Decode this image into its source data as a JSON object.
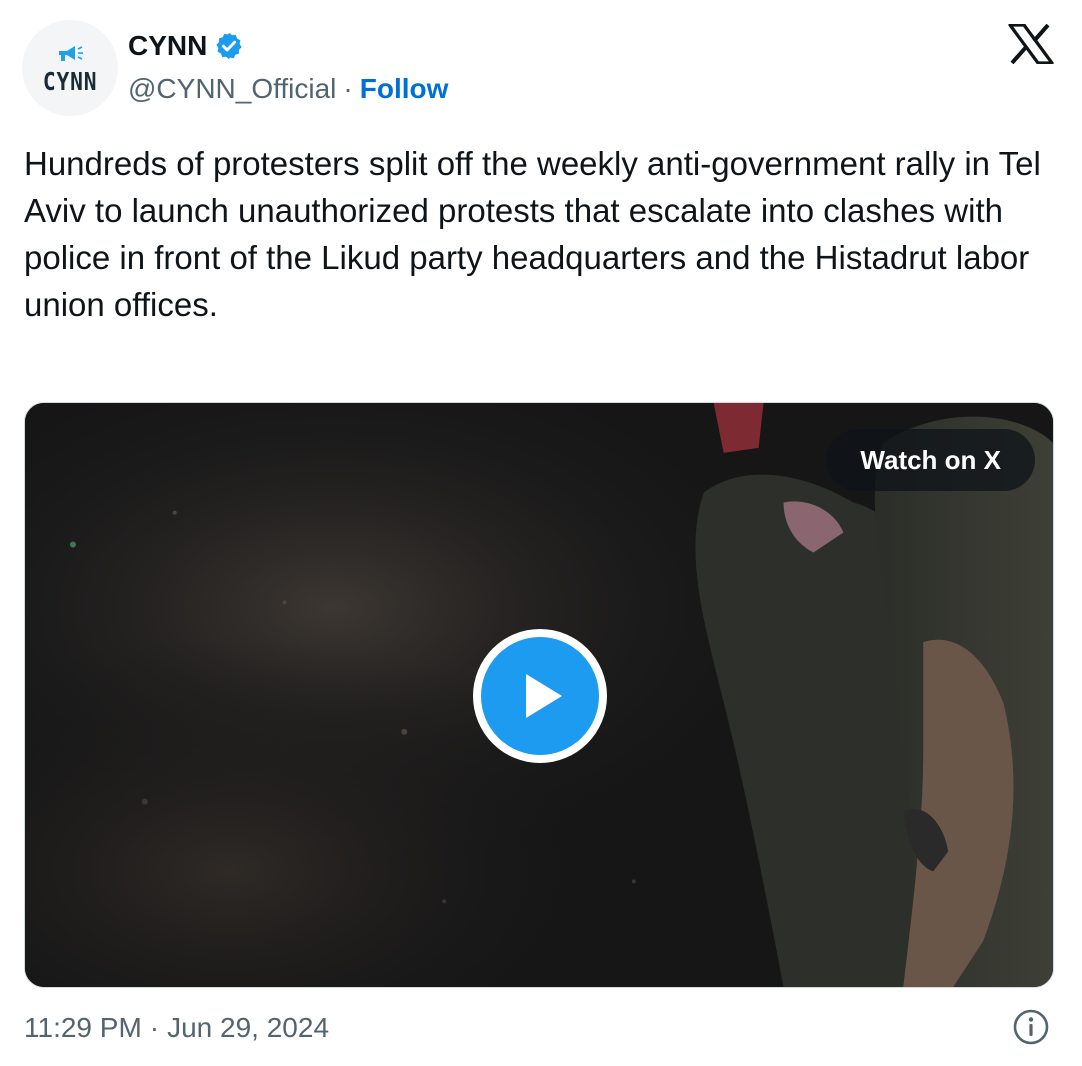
{
  "author": {
    "display_name": "CYNN",
    "handle": "@CYNN_Official",
    "avatar_text": "CYNN",
    "verified": true
  },
  "header": {
    "separator": "·",
    "follow_label": "Follow",
    "platform_icon": "x-logo-icon"
  },
  "tweet": {
    "text": "Hundreds of protesters split off the weekly anti-government rally in Tel Aviv to launch unauthorized protests that escalate into clashes with police in front of the Likud party headquarters and the Histadrut labor union offices."
  },
  "media": {
    "type": "video",
    "watch_label": "Watch on X",
    "play_icon": "play-icon"
  },
  "footer": {
    "time": "11:29 PM",
    "separator": "·",
    "date": "Jun 29, 2024",
    "info_icon": "info-icon"
  },
  "colors": {
    "accent": "#1d9bf0",
    "link": "#006fd6",
    "text": "#0f1419",
    "muted": "#536471",
    "border": "#cfd9de"
  }
}
